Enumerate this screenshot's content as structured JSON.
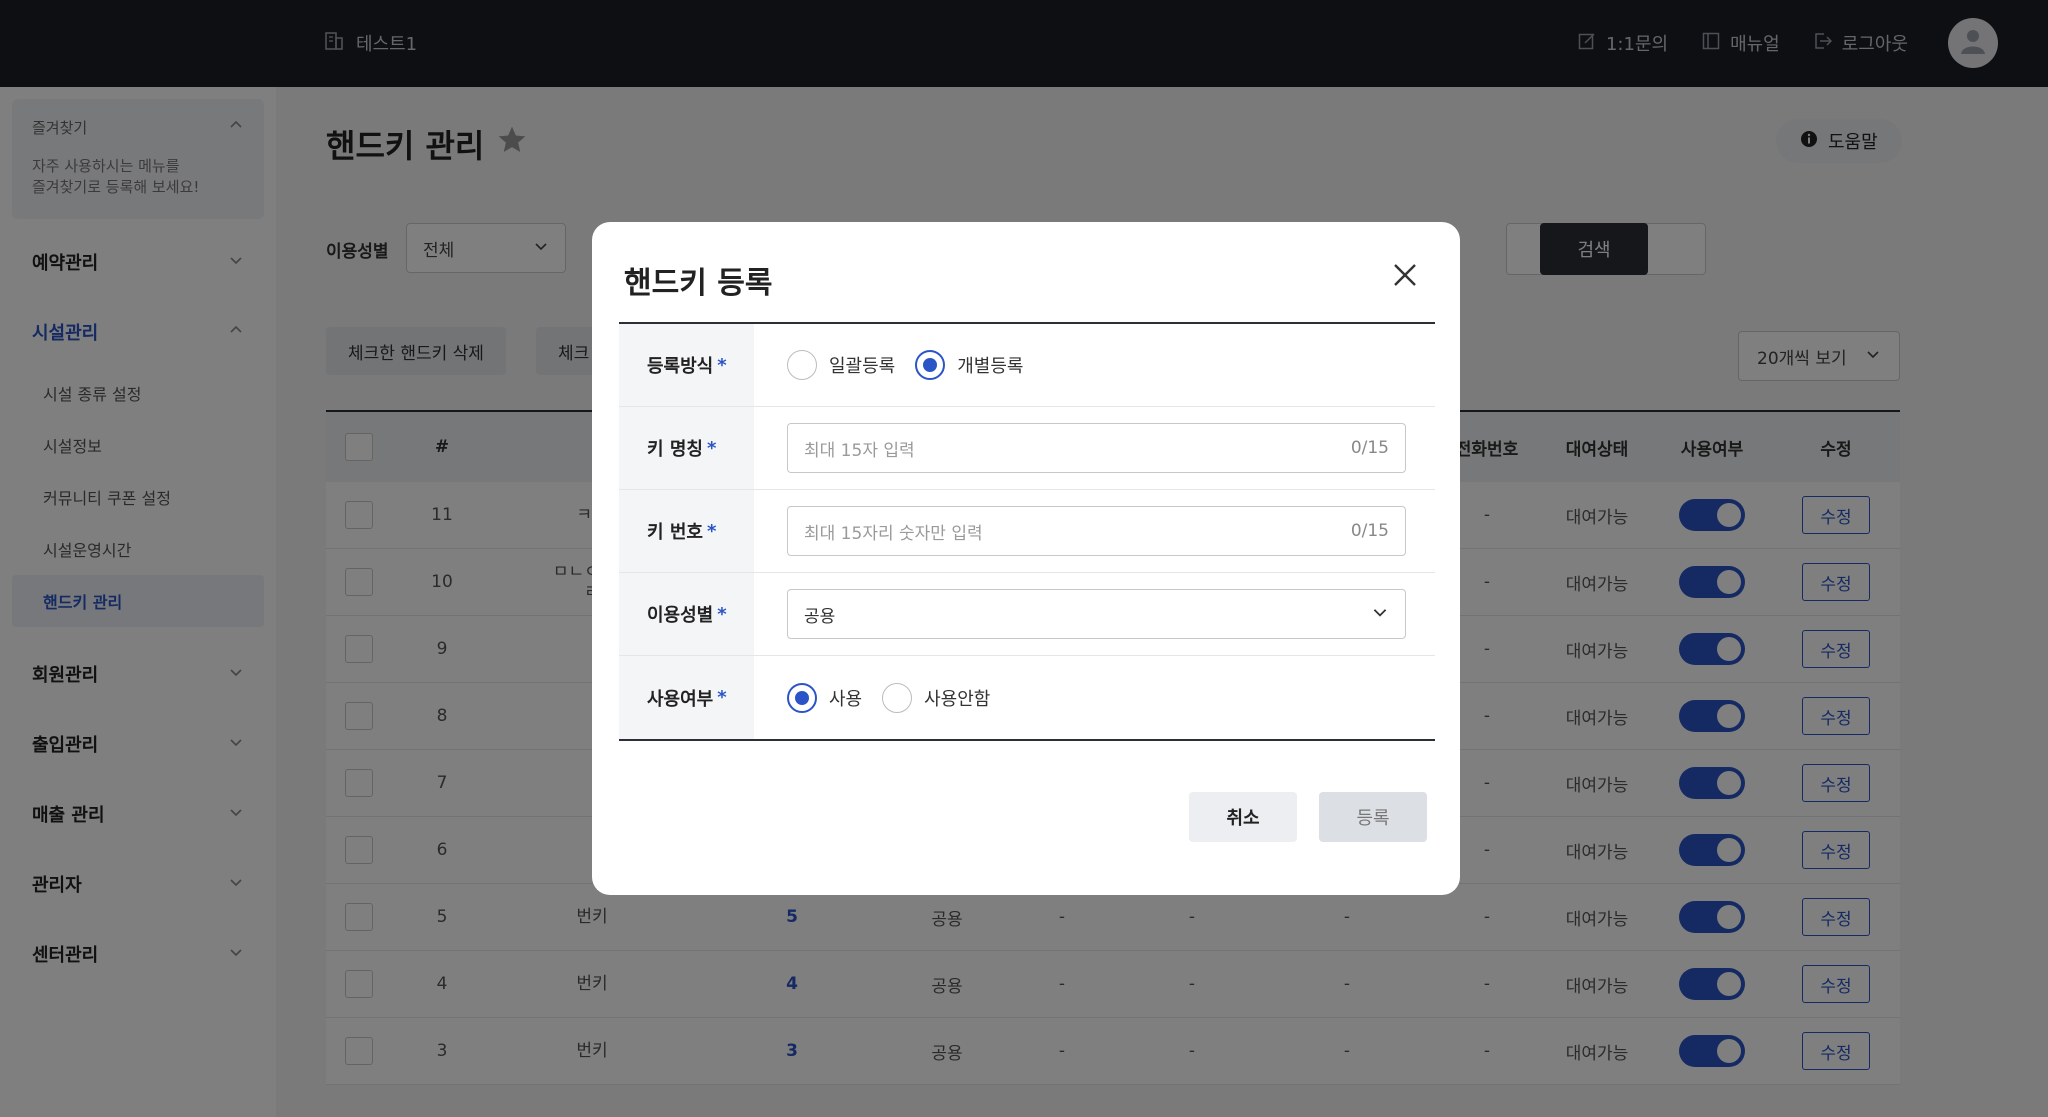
{
  "header": {
    "brand": "테스트1",
    "actions": [
      {
        "label": "1:1문의",
        "icon": "edit-icon"
      },
      {
        "label": "매뉴얼",
        "icon": "manual-icon"
      },
      {
        "label": "로그아웃",
        "icon": "logout-icon"
      }
    ]
  },
  "sidebar": {
    "favorites_title": "즐겨찾기",
    "favorites_desc": "자주 사용하시는 메뉴를\n즐겨찾기로 등록해 보세요!",
    "groups": [
      {
        "label": "예약관리"
      },
      {
        "label": "시설관리",
        "sub": [
          "시설 종류 설정",
          "시설정보",
          "커뮤니티 쿠폰 설정",
          "시설운영시간",
          "핸드키 관리"
        ]
      },
      {
        "label": "회원관리"
      },
      {
        "label": "출입관리"
      },
      {
        "label": "매출 관리"
      },
      {
        "label": "관리자"
      },
      {
        "label": "센터관리"
      }
    ]
  },
  "main": {
    "title": "핸드키 관리",
    "help_label": "도움말",
    "filter_label": "이용성별",
    "filter_value": "전체",
    "search_label": "검색",
    "delete_checked": "체크한 핸드키 삭제",
    "action_2": "체크",
    "per_page": "20개씩 보기",
    "columns": {
      "num": "#",
      "phone": "전화번호",
      "status": "대여상태",
      "use": "사용여부",
      "edit": "수정"
    },
    "rows": [
      {
        "num": "11",
        "name": "ㅋㅋ",
        "key": "",
        "gender": "",
        "a": "",
        "b": "",
        "c": "",
        "phone": "-",
        "status": "대여가능",
        "edit": "수정"
      },
      {
        "num": "10",
        "name": "ㅁㄴㅇㄹㅁ\nㄹ",
        "key": "",
        "gender": "",
        "a": "",
        "b": "",
        "c": "",
        "phone": "-",
        "status": "대여가능",
        "edit": "수정"
      },
      {
        "num": "9",
        "name": "",
        "key": "",
        "gender": "",
        "a": "",
        "b": "",
        "c": "",
        "phone": "-",
        "status": "대여가능",
        "edit": "수정"
      },
      {
        "num": "8",
        "name": "",
        "key": "",
        "gender": "",
        "a": "",
        "b": "",
        "c": "",
        "phone": "-",
        "status": "대여가능",
        "edit": "수정"
      },
      {
        "num": "7",
        "name": "",
        "key": "",
        "gender": "",
        "a": "",
        "b": "",
        "c": "",
        "phone": "-",
        "status": "대여가능",
        "edit": "수정"
      },
      {
        "num": "6",
        "name": "",
        "key": "",
        "gender": "",
        "a": "",
        "b": "",
        "c": "",
        "phone": "-",
        "status": "대여가능",
        "edit": "수정"
      },
      {
        "num": "5",
        "name": "번키",
        "key": "5",
        "gender": "공용",
        "a": "-",
        "b": "-",
        "c": "-",
        "phone": "-",
        "status": "대여가능",
        "edit": "수정"
      },
      {
        "num": "4",
        "name": "번키",
        "key": "4",
        "gender": "공용",
        "a": "-",
        "b": "-",
        "c": "-",
        "phone": "-",
        "status": "대여가능",
        "edit": "수정"
      },
      {
        "num": "3",
        "name": "번키",
        "key": "3",
        "gender": "공용",
        "a": "-",
        "b": "-",
        "c": "-",
        "phone": "-",
        "status": "대여가능",
        "edit": "수정"
      }
    ]
  },
  "modal": {
    "title": "핸드키 등록",
    "required_mark": "*",
    "reg_method_label": "등록방식",
    "reg_options": [
      "일괄등록",
      "개별등록"
    ],
    "key_name_label": "키 명칭",
    "key_name_placeholder": "최대 15자 입력",
    "key_name_counter": "0/15",
    "key_number_label": "키 번호",
    "key_number_placeholder": "최대 15자리 숫자만 입력",
    "key_number_counter": "0/15",
    "gender_label": "이용성별",
    "gender_value": "공용",
    "use_label": "사용여부",
    "use_options": [
      "사용",
      "사용안함"
    ],
    "cancel": "취소",
    "submit": "등록"
  },
  "colors": {
    "accent": "#2b55c7",
    "header_bg": "#1b1f27"
  }
}
